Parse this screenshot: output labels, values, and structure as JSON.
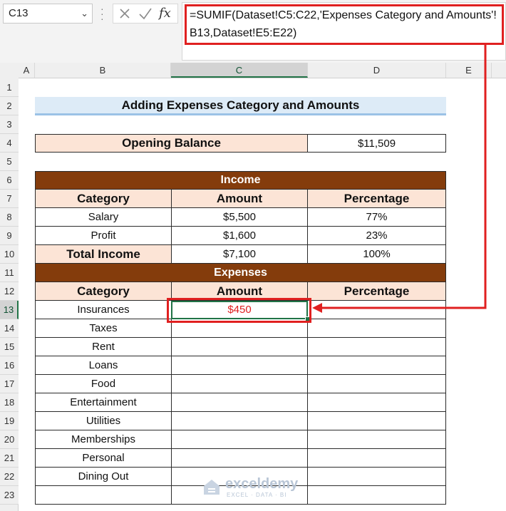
{
  "namebox": {
    "value": "C13"
  },
  "formula": {
    "text": "=SUMIF(Dataset!C5:C22,'Expenses Category and Amounts'!B13,Dataset!E5:E22)",
    "fx_label": "fx"
  },
  "columns": [
    "A",
    "B",
    "C",
    "D",
    "E"
  ],
  "rows": [
    "1",
    "2",
    "3",
    "4",
    "5",
    "6",
    "7",
    "8",
    "9",
    "10",
    "11",
    "12",
    "13",
    "14",
    "15",
    "16",
    "17",
    "18",
    "19",
    "20",
    "21",
    "22",
    "23"
  ],
  "sheet": {
    "title": "Adding Expenses Category and Amounts",
    "opening_balance": {
      "label": "Opening Balance",
      "value": "$11,509"
    },
    "income": {
      "section": "Income",
      "headers": [
        "Category",
        "Amount",
        "Percentage"
      ],
      "rows": [
        {
          "category": "Salary",
          "amount": "$5,500",
          "percentage": "77%"
        },
        {
          "category": "Profit",
          "amount": "$1,600",
          "percentage": "23%"
        }
      ],
      "total": {
        "label": "Total Income",
        "amount": "$7,100",
        "percentage": "100%"
      }
    },
    "expenses": {
      "section": "Expenses",
      "headers": [
        "Category",
        "Amount",
        "Percentage"
      ],
      "rows": [
        {
          "category": "Insurances",
          "amount": "$450",
          "percentage": ""
        },
        {
          "category": "Taxes",
          "amount": "",
          "percentage": ""
        },
        {
          "category": "Rent",
          "amount": "",
          "percentage": ""
        },
        {
          "category": "Loans",
          "amount": "",
          "percentage": ""
        },
        {
          "category": "Food",
          "amount": "",
          "percentage": ""
        },
        {
          "category": "Entertainment",
          "amount": "",
          "percentage": ""
        },
        {
          "category": "Utilities",
          "amount": "",
          "percentage": ""
        },
        {
          "category": "Memberships",
          "amount": "",
          "percentage": ""
        },
        {
          "category": "Personal",
          "amount": "",
          "percentage": ""
        },
        {
          "category": "Dining Out",
          "amount": "",
          "percentage": ""
        },
        {
          "category": "",
          "amount": "",
          "percentage": ""
        }
      ]
    }
  },
  "watermark": {
    "name": "exceldemy",
    "tagline": "EXCEL · DATA · BI"
  },
  "colors": {
    "highlight": "#e02020",
    "selection": "#217346",
    "section_fill": "#843c0c",
    "header_fill": "#fce4d6",
    "title_fill": "#ddebf7"
  }
}
